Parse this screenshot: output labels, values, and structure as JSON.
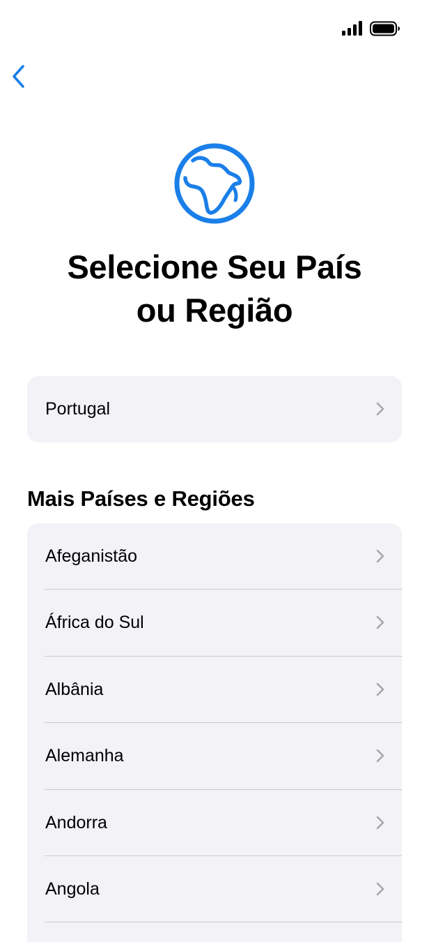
{
  "status_bar": {
    "signal_icon": "cellular-signal-icon",
    "battery_icon": "battery-full-icon"
  },
  "nav": {
    "back_icon": "chevron-left-icon"
  },
  "header": {
    "icon": "globe-africa-icon",
    "title_line1": "Selecione Seu País",
    "title_line2": "ou Região"
  },
  "current_region": {
    "label": "Portugal"
  },
  "more_section": {
    "title": "Mais Países e Regiões",
    "items": [
      {
        "label": "Afeganistão"
      },
      {
        "label": "África do Sul"
      },
      {
        "label": "Albânia"
      },
      {
        "label": "Alemanha"
      },
      {
        "label": "Andorra"
      },
      {
        "label": "Angola"
      }
    ]
  },
  "colors": {
    "accent": "#1a7fe8",
    "group_background": "#f2f2f7",
    "chevron": "#a3a3a8",
    "divider": "#c8c8cd"
  }
}
